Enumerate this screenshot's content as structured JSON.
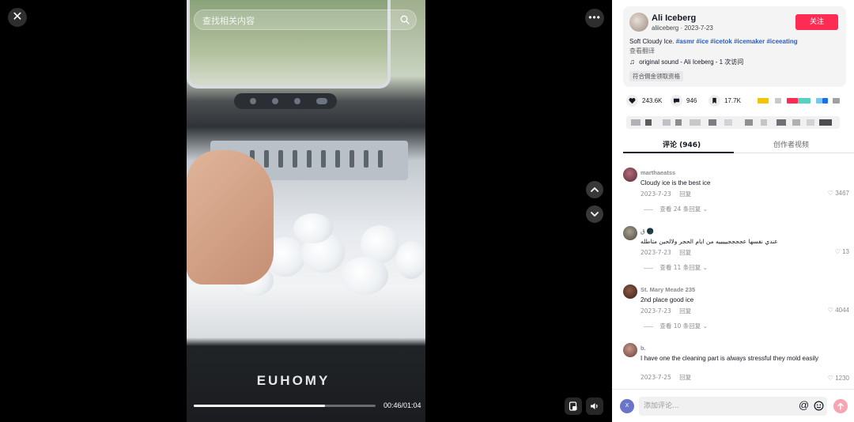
{
  "player": {
    "search_placeholder": "查找相关内容",
    "time": "00:46/01:04",
    "progress": 0.72,
    "brand_text": "EUHOMY"
  },
  "author": {
    "name": "Ali Iceberg",
    "meta": "aliiceberg · 2023-7-23",
    "follow_label": "关注",
    "description": "Soft Cloudy Ice.",
    "tags": "#asmr #ice #icetok #icemaker #iceeating",
    "translate_label": "查看翻译",
    "sound": "original sound - Ali Iceberg - 1 次访问",
    "eligible_label": "符合佣金领取资格"
  },
  "stats": {
    "likes": "243.6K",
    "comments": "946",
    "saves": "17.7K"
  },
  "colors": {
    "accent": "#fe2c55",
    "link": "#2b5db9"
  },
  "tabs": {
    "comments": "评论 (946)",
    "creator_videos": "创作者视频"
  },
  "comments": [
    {
      "user": "marthaeatss",
      "text": "Cloudy ice is the best ice",
      "date": "2023-7-23",
      "reply": "回复",
      "likes": "3467",
      "view_replies": "查看 24 条回复"
    },
    {
      "user": "ق 🌑",
      "text": "عندي نفسها عججججيييييه من ايام الحجر ولالحين متاطله",
      "date": "2023-7-23",
      "reply": "回复",
      "likes": "13",
      "view_replies": "查看 11 条回复"
    },
    {
      "user": "St. Mary Meade 235",
      "text": "2nd place good ice",
      "date": "2023-7-23",
      "reply": "回复",
      "likes": "4044",
      "view_replies": "查看 10 条回复"
    },
    {
      "user": "b.",
      "text": "I have one the cleaning part is always stressful they mold easily",
      "date": "2023-7-25",
      "reply": "回复",
      "likes": "1230"
    }
  ],
  "composer": {
    "avatar_letter": "X",
    "placeholder": "添加评论..."
  }
}
